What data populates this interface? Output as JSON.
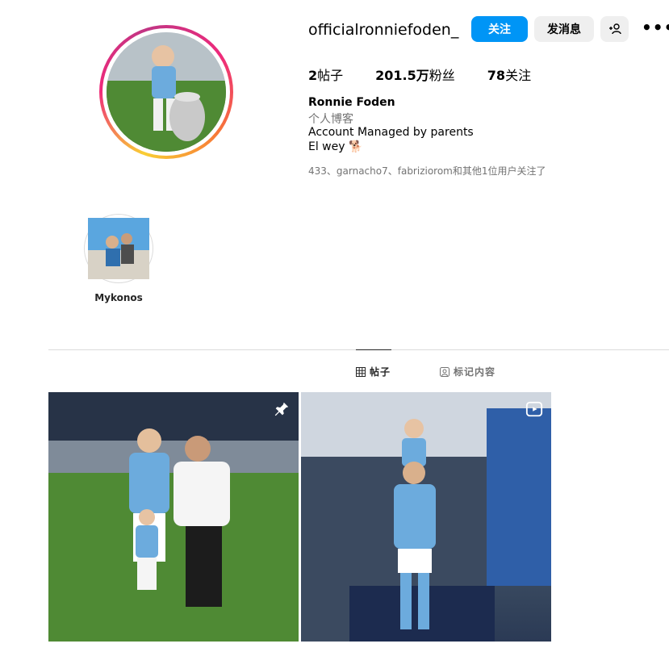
{
  "profile": {
    "username": "officialronniefoden_",
    "full_name": "Ronnie Foden",
    "category": "个人博客",
    "bio_line1": "Account Managed by parents",
    "bio_line2": "El wey 🐕",
    "followed_by": "433、garnacho7、fabriziorom和其他1位用户关注了"
  },
  "actions": {
    "follow": "关注",
    "message": "发消息",
    "add_user": "+👤",
    "more": "•••"
  },
  "stats": {
    "posts_count": "2",
    "posts_label": "帖子",
    "followers_count": "201.5万",
    "followers_label": "粉丝",
    "following_count": "78",
    "following_label": "关注"
  },
  "highlights": [
    {
      "label": "Mykonos"
    }
  ],
  "tabs": {
    "posts": "帖子",
    "tagged": "标记内容"
  },
  "colors": {
    "accent": "#0095f6",
    "button_gray": "#efefef",
    "secondary_text": "#737373"
  },
  "icons": {
    "grid": "grid-icon",
    "tag": "tag-icon",
    "pin": "pin-icon",
    "reel": "reel-icon"
  }
}
